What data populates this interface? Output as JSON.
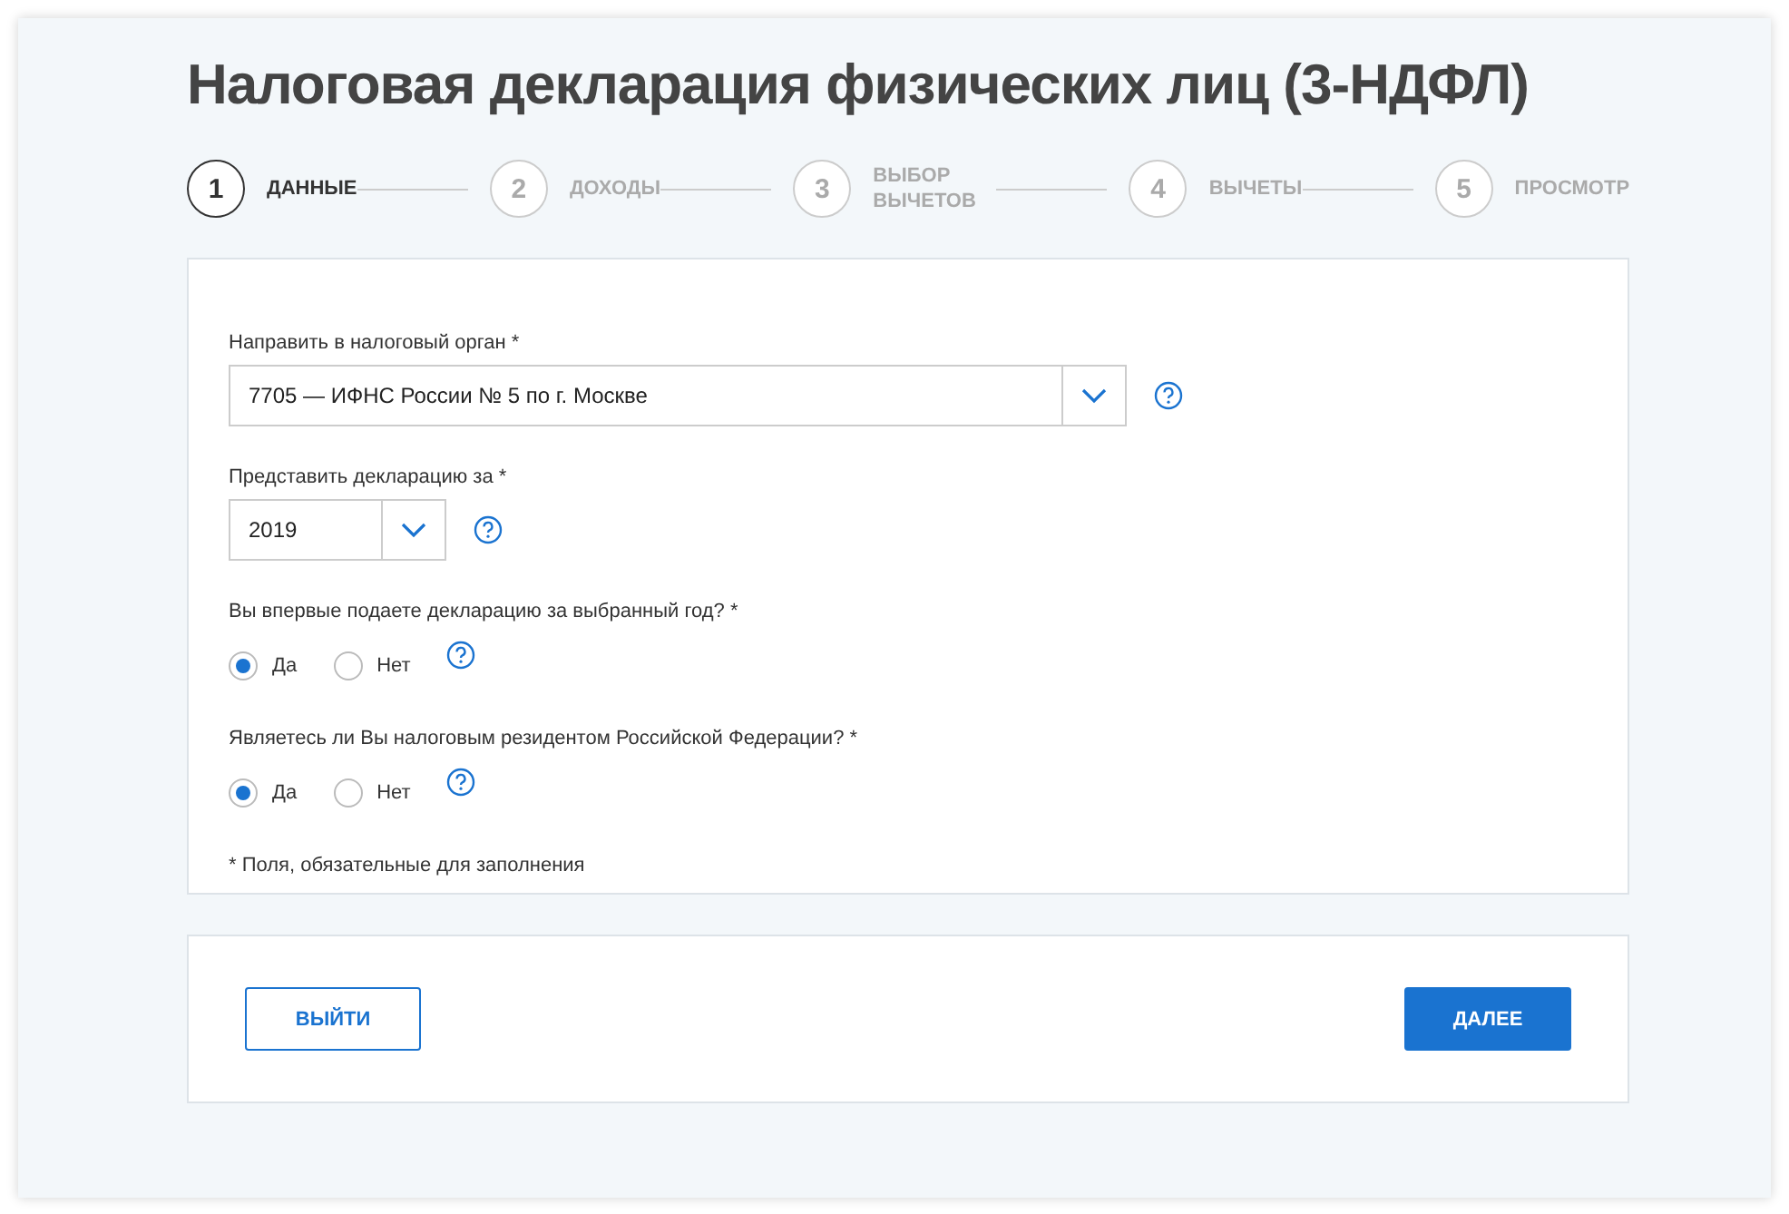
{
  "title": "Налоговая декларация физических лиц (3-НДФЛ)",
  "steps": [
    {
      "number": "1",
      "label": "ДАННЫЕ",
      "selected": true
    },
    {
      "number": "2",
      "label": "ДОХОДЫ",
      "selected": false
    },
    {
      "number": "3",
      "label": "ВЫБОР ВЫЧЕТОВ",
      "selected": false
    },
    {
      "number": "4",
      "label": "ВЫЧЕТЫ",
      "selected": false
    },
    {
      "number": "5",
      "label": "ПРОСМОТР",
      "selected": false
    }
  ],
  "form": {
    "fields": [
      {
        "kind": "select",
        "label": "Направить в налоговый орган *",
        "value": "7705 — ИФНС России № 5 по г. Москве"
      },
      {
        "kind": "select",
        "label": "Представить декларацию за *",
        "value": "2019"
      },
      {
        "kind": "radio",
        "label": "Вы впервые подаете декларацию за выбранный год? *",
        "options": [
          {
            "label": "Да",
            "selected": true
          },
          {
            "label": "Нет",
            "selected": false
          }
        ]
      },
      {
        "kind": "radio",
        "label": "Являетесь ли Вы налоговым резидентом Российской Федерации? *",
        "options": [
          {
            "label": "Да",
            "selected": true
          },
          {
            "label": "Нет",
            "selected": false
          }
        ]
      }
    ],
    "note": "* Поля, обязательные для заполнения"
  },
  "buttons": [
    {
      "label": "ВЫЙТИ",
      "kind": "secondary"
    },
    {
      "label": "ДАЛЕЕ",
      "kind": "primary"
    }
  ]
}
